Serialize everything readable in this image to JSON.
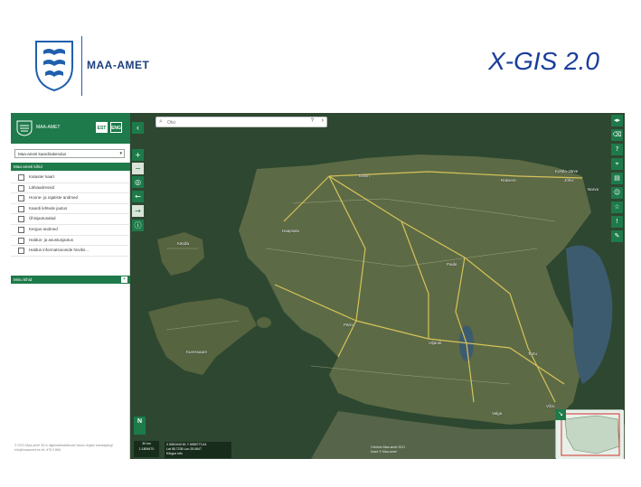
{
  "slide": {
    "logo_text": "MAA-AMET",
    "title": "X-GIS 2.0"
  },
  "panel": {
    "logo_text": "MAA-AMET",
    "lang_est": "EST",
    "lang_eng": "ENG",
    "map_select": "Maa-ameti kaardirakendus",
    "group_main": "Maa-ameti kihid",
    "layers": [
      "Kataster kaart",
      "Lähiaadressid",
      "Hoone- ja rajatiste andmed",
      "Kaardi lehtede jaotus",
      "Ühisjaotusalad",
      "Kergus andmed",
      "Haldus- ja asustusjaotus",
      "Haldus informatsioonide hüvitis..."
    ],
    "group_user": "Minu kihid",
    "footer": "© 2021 Maa-amet 3D & digimaailmaüksuse üksus\nregistri kasutajatugi info@maaamet.ee tel. 675 0 866"
  },
  "map": {
    "search_placeholder": "Otsi",
    "coords_text": [
      "X 6581040.81 Y 6589773.44",
      "Lat 58.7235 Lon 25.0847",
      "Kõrgus info"
    ],
    "scale_text": [
      "30 km",
      "1:1806470"
    ],
    "attribution": [
      "Ortofoto Maa-amet 2021",
      "Kaart © Maa-amet"
    ],
    "places": [
      "Tallinn",
      "Kohtla-Järve",
      "Narva",
      "Paide",
      "Pärnu",
      "Viljandi",
      "Tartu",
      "Valga",
      "Võru",
      "Haapsalu",
      "Kärdla",
      "Kuressaare",
      "Rakvere",
      "Jõhvi"
    ]
  },
  "colors": {
    "brand_green": "#1e7a4a",
    "title_blue": "#1a3d9c",
    "sea": "#2f4a34",
    "land": "#5c6b45"
  },
  "icons": {
    "right_tools": [
      "expand-icon",
      "eraser-icon",
      "help-icon",
      "location-icon",
      "print-icon",
      "user-icon",
      "star-icon",
      "info-icon",
      "ruler-icon"
    ],
    "left_tools": [
      "zoom-in-icon",
      "zoom-out-icon",
      "locate-icon",
      "back-icon",
      "forward-icon",
      "info-circle-icon"
    ]
  }
}
